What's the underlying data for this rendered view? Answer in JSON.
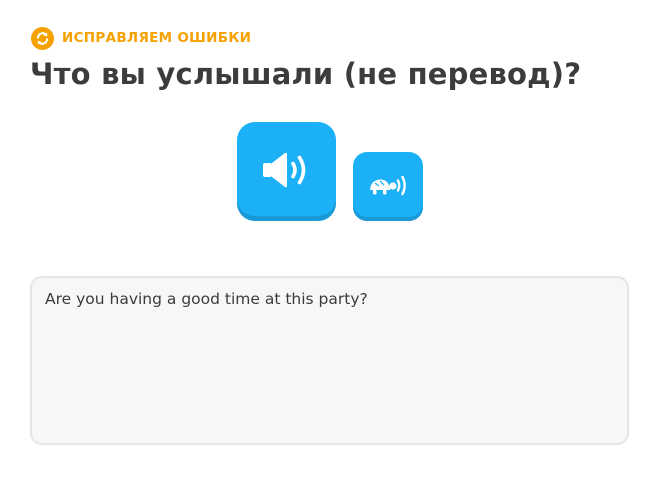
{
  "header": {
    "badge_icon": "refresh-icon",
    "badge_label": "ИСПРАВЛЯЕМ ОШИБКИ",
    "title": "Что вы услышали (не перевод)?"
  },
  "audio": {
    "play_icon": "speaker-icon",
    "slow_icon": "turtle-speaker-icon"
  },
  "answer": {
    "value": "Are you having a good time at this party?"
  },
  "colors": {
    "accent_orange": "#f5a100",
    "audio_blue": "#1cb0f6",
    "audio_blue_shadow": "#1899d6",
    "text_dark": "#3c3c3c",
    "box_bg": "#f7f7f7",
    "box_border": "#e5e5e5"
  }
}
